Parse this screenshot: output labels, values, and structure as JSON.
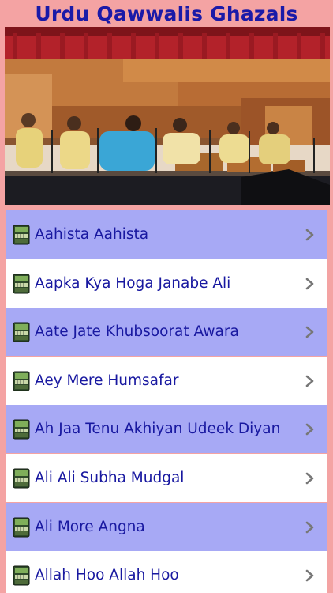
{
  "app": {
    "title": "Urdu Qawwalis Ghazals"
  },
  "banner": {
    "image_name": "qawwali-performers-photo"
  },
  "list": {
    "chevron_icon": "chevron-right-icon",
    "item_icon": "harmonium-book-icon",
    "colors": {
      "odd_row": "#a7a9f5",
      "even_row": "#ffffff",
      "text": "#1818a0",
      "page_background": "#f4a3a3"
    },
    "items": [
      {
        "label": "Aahista Aahista"
      },
      {
        "label": "Aapka Kya Hoga Janabe Ali"
      },
      {
        "label": "Aate Jate Khubsoorat Awara"
      },
      {
        "label": "Aey Mere Humsafar"
      },
      {
        "label": "Ah Jaa Tenu Akhiyan Udeek Diyan"
      },
      {
        "label": "Ali Ali Subha Mudgal"
      },
      {
        "label": "Ali More Angna"
      },
      {
        "label": "Allah Hoo Allah Hoo"
      }
    ]
  }
}
